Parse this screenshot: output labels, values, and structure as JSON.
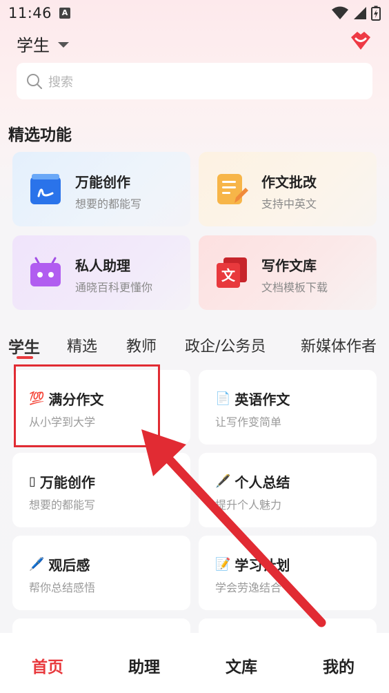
{
  "status_bar": {
    "time": "11:46",
    "notification_badge": "A"
  },
  "header": {
    "role": "学生",
    "vip_icon": "lips-vip-icon"
  },
  "search": {
    "placeholder": "搜索"
  },
  "featured": {
    "title": "精选功能",
    "cards": [
      {
        "title": "万能创作",
        "subtitle": "想要的都能写",
        "icon": "pen-note-icon"
      },
      {
        "title": "作文批改",
        "subtitle": "支持中英文",
        "icon": "edit-document-icon"
      },
      {
        "title": "私人助理",
        "subtitle": "通晓百科更懂你",
        "icon": "robot-icon"
      },
      {
        "title": "写作文库",
        "subtitle": "文档模板下载",
        "icon": "library-icon"
      }
    ]
  },
  "tabs": [
    "学生",
    "精选",
    "教师",
    "政企/公务员",
    "新媒体作者"
  ],
  "active_tab": "学生",
  "templates": [
    {
      "emoji": "💯",
      "title": "满分作文",
      "subtitle": "从小学到大学"
    },
    {
      "emoji": "📄",
      "title": "英语作文",
      "subtitle": "让写作变简单"
    },
    {
      "emoji": "▯",
      "title": "万能创作",
      "subtitle": "想要的都能写"
    },
    {
      "emoji": "🖋️",
      "title": "个人总结",
      "subtitle": "提升个人魅力"
    },
    {
      "emoji": "🖊️",
      "title": "观后感",
      "subtitle": "帮你总结感悟"
    },
    {
      "emoji": "📝",
      "title": "学习计划",
      "subtitle": "学会劳逸结合"
    }
  ],
  "bottom_nav": [
    "首页",
    "助理",
    "文库",
    "我的"
  ],
  "active_nav": "首页",
  "colors": {
    "accent": "#e8393d",
    "annotation": "#e12b33"
  }
}
